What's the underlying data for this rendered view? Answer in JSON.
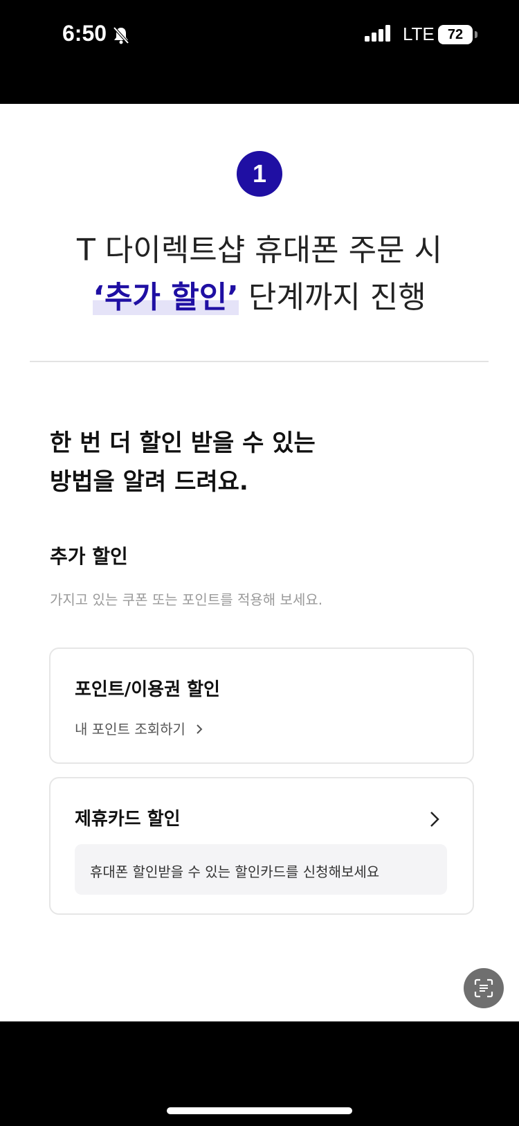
{
  "status_bar": {
    "time": "6:50",
    "network": "LTE",
    "battery": "72",
    "mute_icon": "bell-slash-icon",
    "signal_icon": "signal-bars-icon"
  },
  "step": {
    "number": "1"
  },
  "headline": {
    "line1": "T 다이렉트샵 휴대폰 주문 시",
    "line2_highlight": "‘추가 할인’",
    "line2_rest": " 단계까지 진행"
  },
  "intro": {
    "line1": "한 번 더 할인 받을 수 있는",
    "line2": "방법을 알려 드려요."
  },
  "section": {
    "title": "추가 할인",
    "description": "가지고 있는 쿠폰 또는 포인트를 적용해 보세요."
  },
  "cards": [
    {
      "title": "포인트/이용권 할인",
      "link": "내 포인트 조회하기"
    },
    {
      "title": "제휴카드 할인",
      "banner": "휴대폰 할인받을 수 있는 할인카드를 신청해보세요"
    }
  ],
  "colors": {
    "accent": "#1f0fa3",
    "highlight_bg": "#e5e3f8"
  }
}
